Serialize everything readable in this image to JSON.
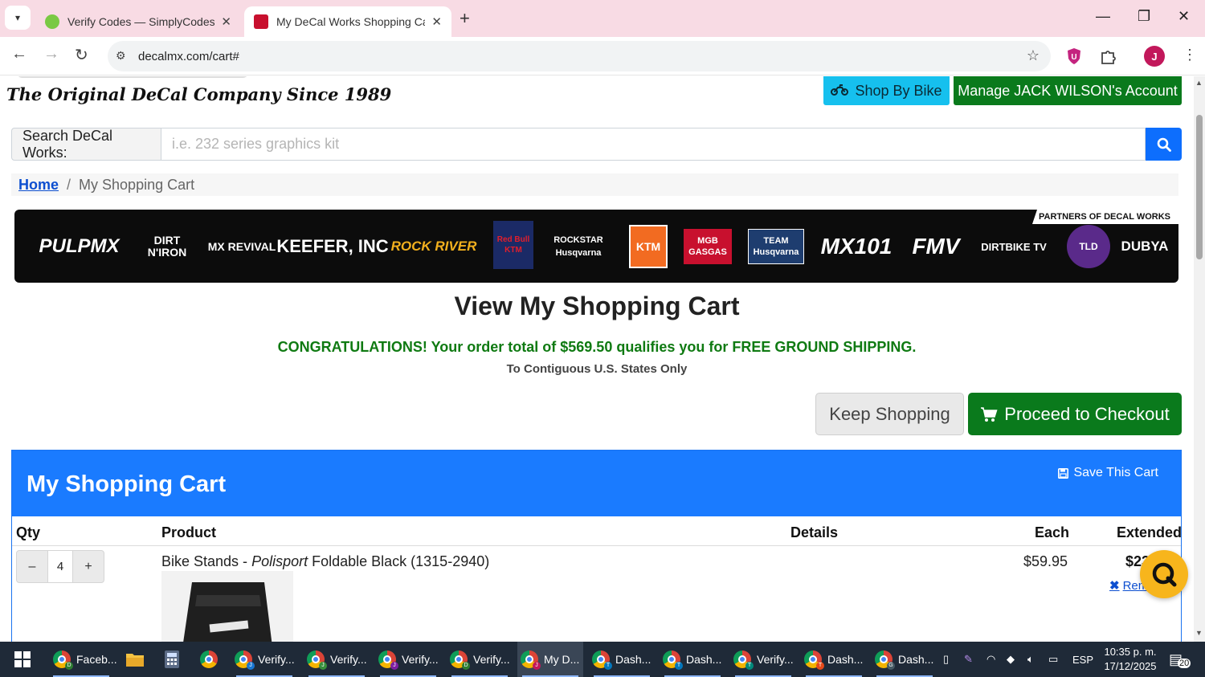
{
  "browser": {
    "tabs": [
      {
        "title": "Verify Codes — SimplyCodes",
        "active": false
      },
      {
        "title": "My DeCal Works Shopping Cart",
        "active": true
      }
    ],
    "url": "decalmx.com/cart#",
    "profile_initial": "J",
    "extension_badge": "U"
  },
  "header": {
    "tagline": "The Original DeCal Company Since 1989",
    "shop_by_bike": "Shop By Bike",
    "manage_account": "Manage JACK WILSON's Account"
  },
  "search": {
    "label": "Search DeCal Works:",
    "placeholder": "i.e. 232 series graphics kit"
  },
  "breadcrumb": {
    "home": "Home",
    "separator": "/",
    "current": "My Shopping Cart"
  },
  "partners": {
    "title": "PARTNERS OF DECAL WORKS",
    "logos": [
      "PULPMX",
      "DIRT N'IRON",
      "MX REVIVAL",
      "KEEFER, INC",
      "ROCK RIVER",
      "Red Bull KTM",
      "ROCKSTAR Husqvarna",
      "KTM",
      "MGB GASGAS",
      "TEAM Husqvarna",
      "MX101",
      "FMV",
      "DIRTBIKE TV",
      "TLD",
      "DUBYA"
    ]
  },
  "cart_page": {
    "heading": "View My Shopping Cart",
    "congrats": "CONGRATULATIONS! Your order total of $569.50 qualifies you for FREE GROUND SHIPPING.",
    "contiguous": "To Contiguous U.S. States Only",
    "keep_shopping": "Keep Shopping",
    "checkout": "Proceed to Checkout"
  },
  "cart": {
    "title": "My Shopping Cart",
    "save": "Save This Cart",
    "columns": {
      "qty": "Qty",
      "product": "Product",
      "details": "Details",
      "each": "Each",
      "extended": "Extended"
    },
    "items": [
      {
        "qty": "4",
        "minus": "–",
        "plus": "+",
        "name_prefix": "Bike Stands - ",
        "brand": "Polisport",
        "name_suffix": " Foldable Black (1315-2940)",
        "each": "$59.95",
        "extended": "$23",
        "remove": "Rem"
      }
    ]
  },
  "taskbar": {
    "items": [
      {
        "label": "Faceb...",
        "badge": "D",
        "badge_color": "#2e7d32"
      },
      {
        "label": "Verify...",
        "badge": "J",
        "badge_color": "#1976d2"
      },
      {
        "label": "Verify...",
        "badge": "J",
        "badge_color": "#388e3c"
      },
      {
        "label": "Verify...",
        "badge": "J",
        "badge_color": "#7b1fa2"
      },
      {
        "label": "Verify...",
        "badge": "D",
        "badge_color": "#2e7d32"
      },
      {
        "label": "My D...",
        "badge": "J",
        "badge_color": "#c2185b"
      },
      {
        "label": "Dash...",
        "badge": "T",
        "badge_color": "#0277bd"
      },
      {
        "label": "Dash...",
        "badge": "T",
        "badge_color": "#0277bd"
      },
      {
        "label": "Verify...",
        "badge": "T",
        "badge_color": "#00897b"
      },
      {
        "label": "Dash...",
        "badge": "T",
        "badge_color": "#e64a19"
      },
      {
        "label": "Dash...",
        "badge": "G",
        "badge_color": "#455a64"
      }
    ],
    "language": "ESP",
    "time": "10:35 p. m.",
    "date": "17/12/2025",
    "notifications": "20"
  }
}
